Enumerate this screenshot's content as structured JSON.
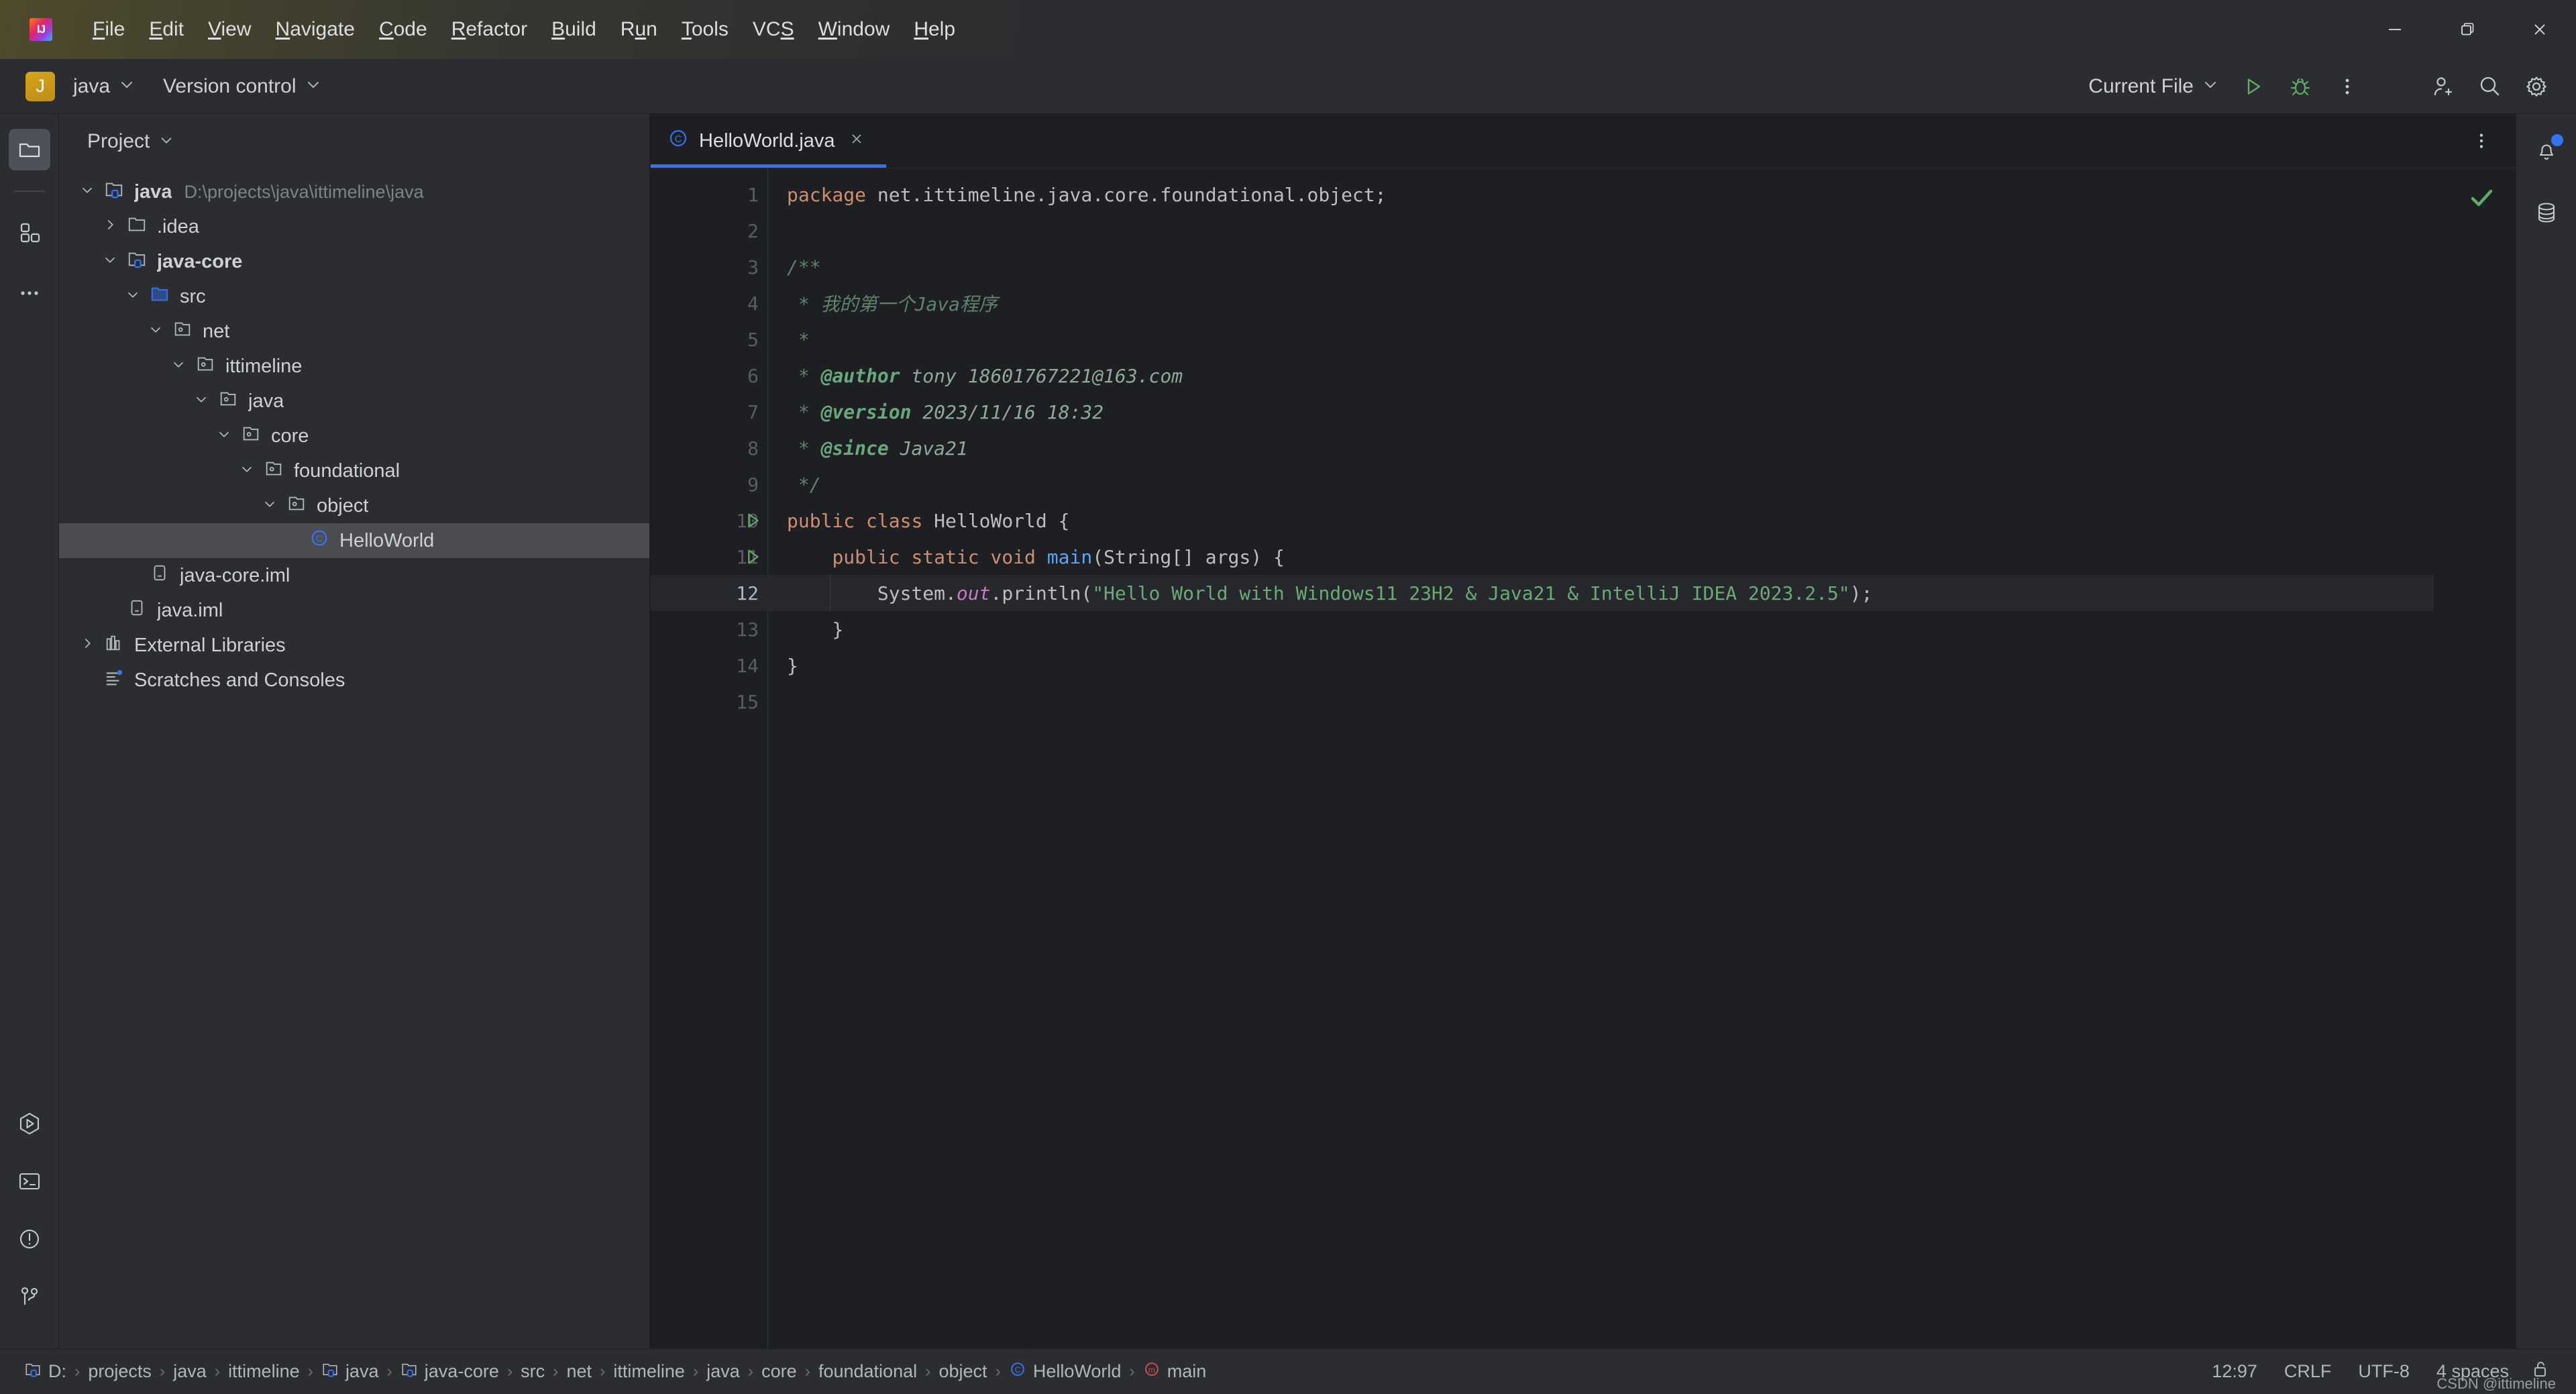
{
  "window": {
    "logo_letters": "IJ",
    "controls": {
      "minimize": "minimize-icon",
      "maximize": "restore-icon",
      "close": "close-icon"
    }
  },
  "menubar": {
    "items": [
      {
        "label": "File",
        "mnemonic": "F"
      },
      {
        "label": "Edit",
        "mnemonic": "E"
      },
      {
        "label": "View",
        "mnemonic": "V"
      },
      {
        "label": "Navigate",
        "mnemonic": "N"
      },
      {
        "label": "Code",
        "mnemonic": "C"
      },
      {
        "label": "Refactor",
        "mnemonic": "R"
      },
      {
        "label": "Build",
        "mnemonic": "B"
      },
      {
        "label": "Run",
        "mnemonic": "u"
      },
      {
        "label": "Tools",
        "mnemonic": "T"
      },
      {
        "label": "VCS",
        "mnemonic": "S"
      },
      {
        "label": "Window",
        "mnemonic": "W"
      },
      {
        "label": "Help",
        "mnemonic": "H"
      }
    ]
  },
  "toolbar": {
    "project_badge": "J",
    "project_name": "java",
    "version_control": "Version control",
    "run_config": "Current File",
    "run_button": "run-icon",
    "debug_button": "debug-icon",
    "more_button": "more-vertical-icon",
    "account_button": "add-user-icon",
    "search_button": "search-icon",
    "settings_button": "gear-icon"
  },
  "left_rail": {
    "top": [
      {
        "name": "project-tool-window",
        "icon": "folder-icon",
        "active": true
      },
      {
        "name": "structure-tool-window",
        "icon": "blocks-icon",
        "active": false
      },
      {
        "name": "more-tool-windows",
        "icon": "ellipsis-icon",
        "active": false
      }
    ],
    "bottom": [
      {
        "name": "run-tool-window",
        "icon": "run-hex-icon"
      },
      {
        "name": "terminal-tool-window",
        "icon": "terminal-icon"
      },
      {
        "name": "problems-tool-window",
        "icon": "warning-circle-icon"
      },
      {
        "name": "git-tool-window",
        "icon": "git-branch-icon"
      }
    ]
  },
  "right_rail": [
    {
      "name": "notifications",
      "icon": "bell-icon",
      "badge": true
    },
    {
      "name": "database-tool-window",
      "icon": "database-icon",
      "badge": false
    }
  ],
  "project_panel": {
    "title": "Project",
    "tree": [
      {
        "label": "java",
        "sublabel": "D:\\projects\\java\\ittimeline\\java",
        "depth": 0,
        "arrow": "down",
        "icon": "module-icon",
        "bold": true,
        "selected": false
      },
      {
        "label": ".idea",
        "sublabel": "",
        "depth": 1,
        "arrow": "right",
        "icon": "folder-icon",
        "bold": false,
        "selected": false
      },
      {
        "label": "java-core",
        "sublabel": "",
        "depth": 1,
        "arrow": "down",
        "icon": "module-icon",
        "bold": true,
        "selected": false
      },
      {
        "label": "src",
        "sublabel": "",
        "depth": 2,
        "arrow": "down",
        "icon": "source-folder-icon",
        "bold": false,
        "selected": false
      },
      {
        "label": "net",
        "sublabel": "",
        "depth": 3,
        "arrow": "down",
        "icon": "package-icon",
        "bold": false,
        "selected": false
      },
      {
        "label": "ittimeline",
        "sublabel": "",
        "depth": 4,
        "arrow": "down",
        "icon": "package-icon",
        "bold": false,
        "selected": false
      },
      {
        "label": "java",
        "sublabel": "",
        "depth": 5,
        "arrow": "down",
        "icon": "package-icon",
        "bold": false,
        "selected": false
      },
      {
        "label": "core",
        "sublabel": "",
        "depth": 6,
        "arrow": "down",
        "icon": "package-icon",
        "bold": false,
        "selected": false
      },
      {
        "label": "foundational",
        "sublabel": "",
        "depth": 7,
        "arrow": "down",
        "icon": "package-icon",
        "bold": false,
        "selected": false
      },
      {
        "label": "object",
        "sublabel": "",
        "depth": 8,
        "arrow": "down",
        "icon": "package-icon",
        "bold": false,
        "selected": false
      },
      {
        "label": "HelloWorld",
        "sublabel": "",
        "depth": 9,
        "arrow": "none",
        "icon": "class-icon",
        "bold": false,
        "selected": true
      },
      {
        "label": "java-core.iml",
        "sublabel": "",
        "depth": 2,
        "arrow": "none",
        "icon": "iml-file-icon",
        "bold": false,
        "selected": false
      },
      {
        "label": "java.iml",
        "sublabel": "",
        "depth": 1,
        "arrow": "none",
        "icon": "iml-file-icon",
        "bold": false,
        "selected": false
      },
      {
        "label": "External Libraries",
        "sublabel": "",
        "depth": 0,
        "arrow": "right",
        "icon": "libraries-icon",
        "bold": false,
        "selected": false
      },
      {
        "label": "Scratches and Consoles",
        "sublabel": "",
        "depth": 0,
        "arrow": "none",
        "icon": "scratches-icon",
        "bold": false,
        "selected": false
      }
    ]
  },
  "editor": {
    "tabs": [
      {
        "label": "HelloWorld.java",
        "icon": "class-icon",
        "active": true,
        "close_icon": "close-icon"
      }
    ],
    "tab_options_icon": "more-vertical-icon",
    "inspection_status_icon": "checkmark-icon",
    "current_line": 12,
    "lines": [
      {
        "n": 1,
        "runmark": false,
        "text": "package net.ittimeline.java.core.foundational.object;"
      },
      {
        "n": 2,
        "runmark": false,
        "text": ""
      },
      {
        "n": 3,
        "runmark": false,
        "text": "/**"
      },
      {
        "n": 4,
        "runmark": false,
        "text": " * 我的第一个Java程序"
      },
      {
        "n": 5,
        "runmark": false,
        "text": " *"
      },
      {
        "n": 6,
        "runmark": false,
        "text": " * @author tony 18601767221@163.com"
      },
      {
        "n": 7,
        "runmark": false,
        "text": " * @version 2023/11/16 18:32"
      },
      {
        "n": 8,
        "runmark": false,
        "text": " * @since Java21"
      },
      {
        "n": 9,
        "runmark": false,
        "text": " */"
      },
      {
        "n": 10,
        "runmark": true,
        "text": "public class HelloWorld {"
      },
      {
        "n": 11,
        "runmark": true,
        "text": "    public static void main(String[] args) {"
      },
      {
        "n": 12,
        "runmark": false,
        "text": "        System.out.println(\"Hello World with Windows11 23H2 & Java21 & IntelliJ IDEA 2023.2.5\");"
      },
      {
        "n": 13,
        "runmark": false,
        "text": "    }"
      },
      {
        "n": 14,
        "runmark": false,
        "text": "}"
      },
      {
        "n": 15,
        "runmark": false,
        "text": ""
      }
    ]
  },
  "statusbar": {
    "breadcrumbs": [
      {
        "label": "D:",
        "icon": "module-icon"
      },
      {
        "label": "projects",
        "icon": ""
      },
      {
        "label": "java",
        "icon": ""
      },
      {
        "label": "ittimeline",
        "icon": ""
      },
      {
        "label": "java",
        "icon": "module-icon"
      },
      {
        "label": "java-core",
        "icon": "module-icon"
      },
      {
        "label": "src",
        "icon": ""
      },
      {
        "label": "net",
        "icon": ""
      },
      {
        "label": "ittimeline",
        "icon": ""
      },
      {
        "label": "java",
        "icon": ""
      },
      {
        "label": "core",
        "icon": ""
      },
      {
        "label": "foundational",
        "icon": ""
      },
      {
        "label": "object",
        "icon": ""
      },
      {
        "label": "HelloWorld",
        "icon": "class-icon"
      },
      {
        "label": "main",
        "icon": "method-icon"
      }
    ],
    "separator": "›",
    "caret_position": "12:97",
    "line_separator": "CRLF",
    "encoding": "UTF-8",
    "indent": "4 spaces",
    "lock_icon": "unlocked-icon",
    "watermark": "CSDN @ittimeline"
  },
  "colors": {
    "accent_blue": "#3574f0",
    "panel_bg": "#2b2d30",
    "editor_bg": "#1e1f22",
    "keyword": "#cf8e6d",
    "string": "#6aab73",
    "comment": "#5f826b",
    "method": "#56a8f5",
    "static_field": "#c77dbb",
    "run_green": "#5fad65",
    "badge_gold": "#d6a41a",
    "class_icon_blue": "#3574f0",
    "method_icon_red": "#c75450"
  }
}
